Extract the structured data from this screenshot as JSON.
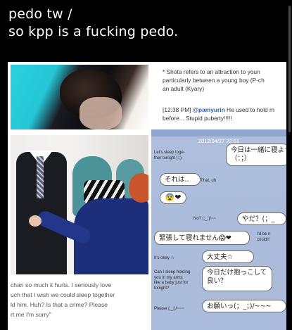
{
  "post": {
    "caption_line1": "pedo tw /",
    "caption_line2": "so kpp is a fucking pedo."
  },
  "tweet": {
    "note_line1": "* Shota refers to an attraction to youn",
    "note_line2": "particularly between a young boy (P-ch",
    "note_line3": "an adult (Kyary)",
    "time": "[12:38 PM]",
    "handle": "@pamyurin",
    "text_line1": " He used to hold m",
    "text_line2": "before... Stupid puberty!!!!!"
  },
  "quote": {
    "line1": "chan so much it hurts. I seriously love",
    "line2": "uch that I wish we could sleep together",
    "line3": "ld him. Huh? Is that a crime? Please",
    "line4": "rt me I'm sorry\""
  },
  "chat": {
    "date": "2012/04/27 22:51",
    "b1_line1": "今日は一緒に寝よう",
    "b1_line2": "（：；）",
    "s1_line1": "Let's sleep toge-",
    "s1_line2": "ther tonight (:;)",
    "b2": "それは..",
    "s2": "That, uh",
    "b3": "😨❤",
    "b4": "やだ？(；_",
    "s3": "No? (;_;)/~~",
    "b5": "緊張して寝れません😱❤",
    "s4_line1": "I'd be n",
    "s4_line2": "couldn'",
    "b6": "大丈夫☆",
    "s5": "It's okay ☆",
    "b7_line1": "今日だけ抱っこして",
    "b7_line2": "良い？",
    "s6_line1": "Can I sleep holding",
    "s6_line2": "you in my arms",
    "s6_line3": "like a baby just for",
    "s6_line4": "tonight?",
    "b8": "お願いっ(；_；)/~~~",
    "s7": "Please (;_;)/~~~"
  }
}
